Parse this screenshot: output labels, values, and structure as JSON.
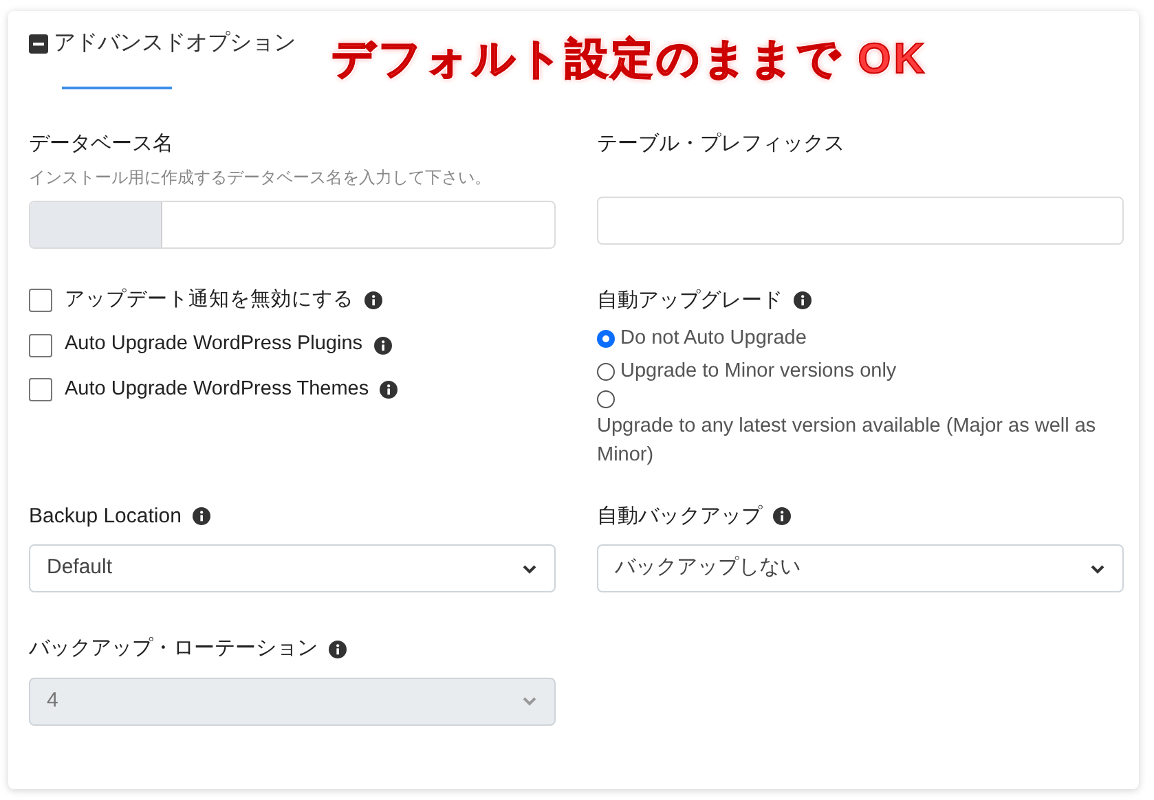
{
  "section": {
    "title": "アドバンスドオプション",
    "expanded": true
  },
  "annotation": "デフォルト設定のままで OK",
  "database_name": {
    "label": "データベース名",
    "hint": "インストール用に作成するデータベース名を入力して下さい。"
  },
  "table_prefix": {
    "label": "テーブル・プレフィックス"
  },
  "checkboxes": [
    {
      "label": "アップデート通知を無効にする",
      "checked": false
    },
    {
      "label": "Auto Upgrade WordPress Plugins",
      "checked": false
    },
    {
      "label": "Auto Upgrade WordPress Themes",
      "checked": false
    }
  ],
  "auto_upgrade": {
    "label": "自動アップグレード",
    "options": [
      {
        "label": "Do not Auto Upgrade",
        "selected": true,
        "wrap": false
      },
      {
        "label": "Upgrade to Minor versions only",
        "selected": false,
        "wrap": false
      },
      {
        "label": "Upgrade to any latest version available (Major as well as Minor)",
        "selected": false,
        "wrap": true
      }
    ]
  },
  "backup_location": {
    "label": "Backup Location",
    "value": "Default",
    "disabled": false
  },
  "auto_backup": {
    "label": "自動バックアップ",
    "value": "バックアップしない",
    "disabled": false
  },
  "backup_rotation": {
    "label": "バックアップ・ローテーション",
    "value": "4",
    "disabled": true
  }
}
